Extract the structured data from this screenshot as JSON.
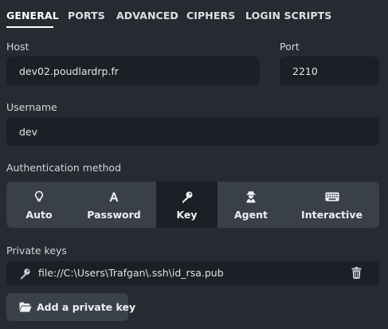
{
  "tabs": {
    "general": "GENERAL",
    "ports": "PORTS",
    "advanced": "ADVANCED",
    "ciphers": "CIPHERS",
    "login_scripts": "LOGIN SCRIPTS",
    "active": "general"
  },
  "host": {
    "label": "Host",
    "value": "dev02.poudlardrp.fr"
  },
  "port": {
    "label": "Port",
    "value": "2210"
  },
  "username": {
    "label": "Username",
    "value": "dev"
  },
  "auth": {
    "label": "Authentication method",
    "selected": "Key",
    "options": [
      {
        "label": "Auto",
        "icon": "lightbulb-icon"
      },
      {
        "label": "Password",
        "icon": "font-a-icon"
      },
      {
        "label": "Key",
        "icon": "key-icon"
      },
      {
        "label": "Agent",
        "icon": "user-secret-icon"
      },
      {
        "label": "Interactive",
        "icon": "keyboard-icon"
      }
    ]
  },
  "private_keys": {
    "label": "Private keys",
    "items": [
      {
        "path": "file://C:\\Users\\Trafgan\\.ssh\\id_rsa.pub",
        "icon": "key-icon"
      }
    ],
    "add_label": "Add a private key",
    "add_icon": "folder-open-icon",
    "delete_icon": "trash-icon"
  },
  "colors": {
    "background": "#262a31",
    "field": "#1c2026",
    "segment": "#39404a",
    "text": "#d7dbe0"
  }
}
